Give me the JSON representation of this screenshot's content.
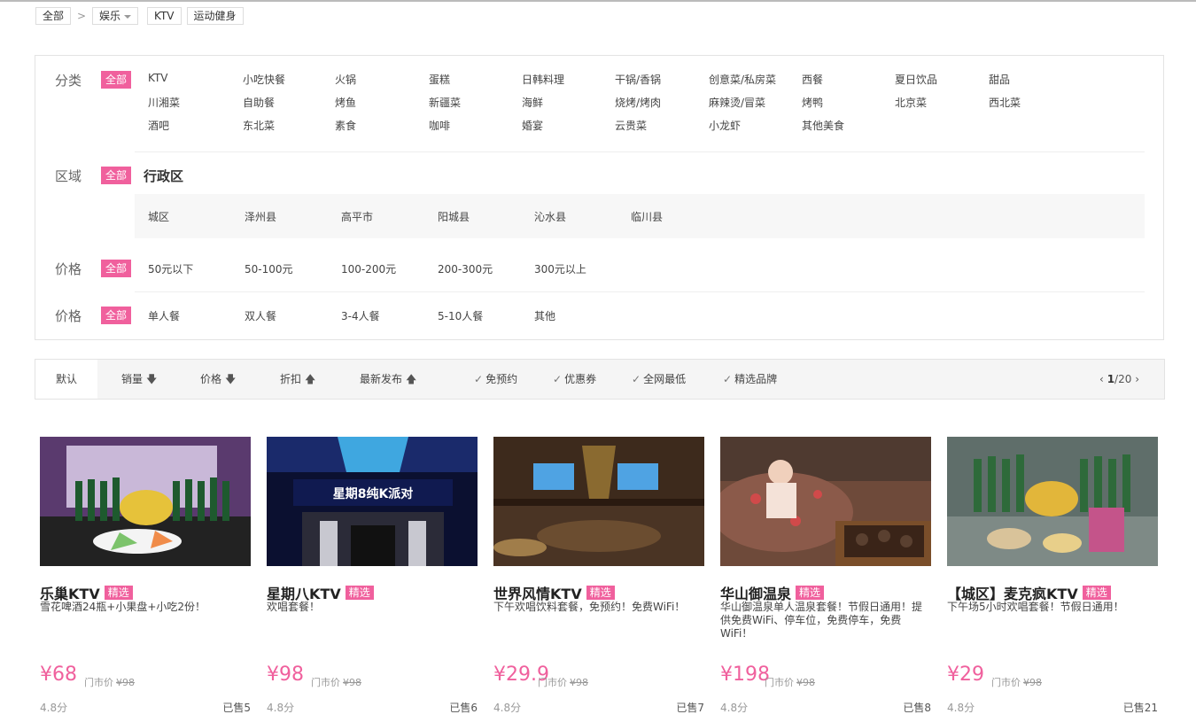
{
  "breadcrumb": {
    "root": "全部",
    "separator": ">",
    "category": "娱乐",
    "tags": [
      "KTV",
      "运动健身"
    ]
  },
  "filters": {
    "all_label": "全部",
    "category": {
      "label": "分类",
      "items": [
        "KTV",
        "小吃快餐",
        "火锅",
        "蛋糕",
        "日韩料理",
        "干锅/香锅",
        "创意菜/私房菜",
        "西餐",
        "夏日饮品",
        "甜品",
        "川湘菜",
        "自助餐",
        "烤鱼",
        "新疆菜",
        "海鲜",
        "烧烤/烤肉",
        "麻辣烫/冒菜",
        "烤鸭",
        "北京菜",
        "西北菜",
        "酒吧",
        "东北菜",
        "素食",
        "咖啡",
        "婚宴",
        "云贵菜",
        "小龙虾",
        "其他美食"
      ]
    },
    "region": {
      "label": "区域",
      "sub_label": "行政区",
      "items": [
        "城区",
        "泽州县",
        "高平市",
        "阳城县",
        "沁水县",
        "临川县"
      ]
    },
    "price": {
      "label": "价格",
      "items": [
        "50元以下",
        "50-100元",
        "100-200元",
        "200-300元",
        "300元以上"
      ]
    },
    "people": {
      "label": "价格",
      "items": [
        "单人餐",
        "双人餐",
        "3-4人餐",
        "5-10人餐",
        "其他"
      ]
    }
  },
  "sort": {
    "default": "默认",
    "sales": "销量",
    "price": "价格",
    "discount": "折扣",
    "newest": "最新发布",
    "checks": [
      "免预约",
      "优惠券",
      "全网最低",
      "精选品牌"
    ],
    "page_current": "1",
    "page_total": "/20"
  },
  "products": [
    {
      "name": "乐巢KTV",
      "tag": "精选",
      "desc": "雪花啤酒24瓶+小果盘+小吃2份！",
      "price": "¥68",
      "market_label": "门市价",
      "market_price": "¥98",
      "rating": "4.8分",
      "sold": "已售5"
    },
    {
      "name": "星期八KTV",
      "tag": "精选",
      "desc": "欢唱套餐！",
      "price": "¥98",
      "market_label": "门市价",
      "market_price": "¥98",
      "rating": "4.8分",
      "sold": "已售6",
      "sign_text": "星期8纯K派对"
    },
    {
      "name": "世界风情KTV",
      "tag": "精选",
      "desc": "下午欢唱饮料套餐，免预约！免费WiFi！",
      "price": "¥29.9",
      "market_label": "门市价",
      "market_price": "¥98",
      "rating": "4.8分",
      "sold": "已售7"
    },
    {
      "name": "华山御温泉",
      "tag": "精选",
      "desc": "华山御温泉单人温泉套餐！节假日通用！提供免费WiFi、停车位，免费停车，免费WiFi！",
      "price": "¥198",
      "market_label": "门市价",
      "market_price": "¥98",
      "rating": "4.8分",
      "sold": "已售8"
    },
    {
      "name": "【城区】麦克疯KTV",
      "tag": "精选",
      "desc": "下午场5小时欢唱套餐！节假日通用！",
      "price": "¥29",
      "market_label": "门市价",
      "market_price": "¥98",
      "rating": "4.8分",
      "sold": "已售21"
    }
  ],
  "colors": {
    "accent": "#f0609d",
    "border": "#e3e3e3"
  }
}
